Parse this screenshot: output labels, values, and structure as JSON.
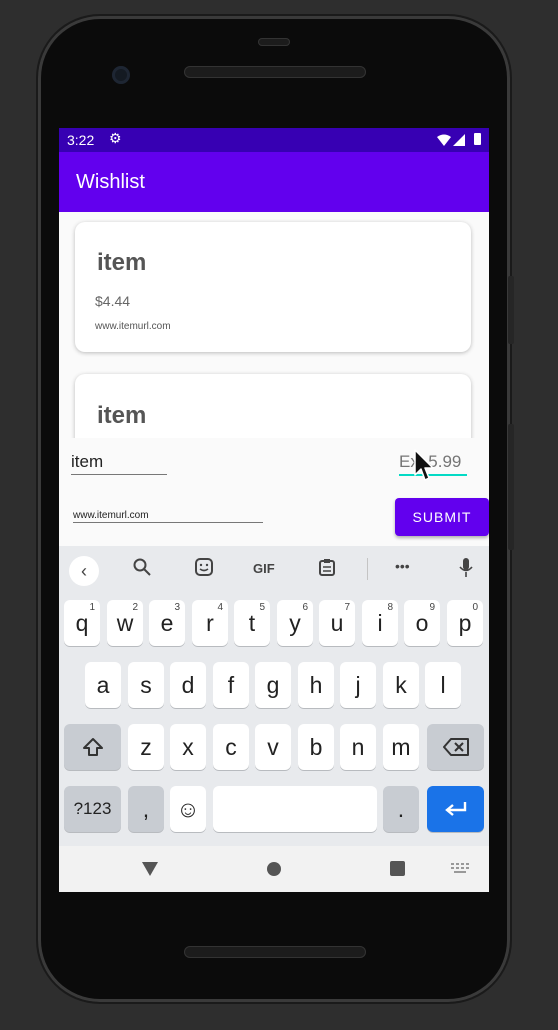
{
  "status_bar": {
    "time": "3:22",
    "settings_icon": "gear-icon",
    "wifi_icon": "wifi-icon",
    "signal_icon": "signal-icon",
    "battery_icon": "battery-icon"
  },
  "app_bar": {
    "title": "Wishlist"
  },
  "items": [
    {
      "name": "item",
      "price": "$4.44",
      "url": "www.itemurl.com"
    },
    {
      "name": "item"
    }
  ],
  "form": {
    "name_value": "item",
    "price_placeholder": "Ex: 5.99",
    "url_value": "www.itemurl.com",
    "submit_label": "SUBMIT"
  },
  "keyboard": {
    "suggestions": {
      "back_icon": "chevron-left-icon",
      "search_icon": "search-icon",
      "sticker_icon": "sticker-icon",
      "gif_label": "GIF",
      "clipboard_icon": "clipboard-icon",
      "more_label": "•••",
      "mic_icon": "mic-icon"
    },
    "row1": [
      {
        "k": "q",
        "n": "1"
      },
      {
        "k": "w",
        "n": "2"
      },
      {
        "k": "e",
        "n": "3"
      },
      {
        "k": "r",
        "n": "4"
      },
      {
        "k": "t",
        "n": "5"
      },
      {
        "k": "y",
        "n": "6"
      },
      {
        "k": "u",
        "n": "7"
      },
      {
        "k": "i",
        "n": "8"
      },
      {
        "k": "o",
        "n": "9"
      },
      {
        "k": "p",
        "n": "0"
      }
    ],
    "row2": [
      "a",
      "s",
      "d",
      "f",
      "g",
      "h",
      "j",
      "k",
      "l"
    ],
    "row3": [
      "z",
      "x",
      "c",
      "v",
      "b",
      "n",
      "m"
    ],
    "shift_icon": "shift-icon",
    "backspace_icon": "backspace-icon",
    "symbols_label": "?123",
    "comma_label": ",",
    "emoji_label": "☺",
    "period_label": ".",
    "enter_icon": "enter-icon"
  },
  "nav_bar": {
    "back_icon": "back-triangle-icon",
    "home_icon": "home-circle-icon",
    "recents_icon": "recents-square-icon",
    "keyboard_switch_icon": "keyboard-icon"
  },
  "colors": {
    "primary": "#6200ee",
    "primary_dark": "#3700b3",
    "accent": "#03dac5",
    "enter_key": "#1a73e8"
  }
}
